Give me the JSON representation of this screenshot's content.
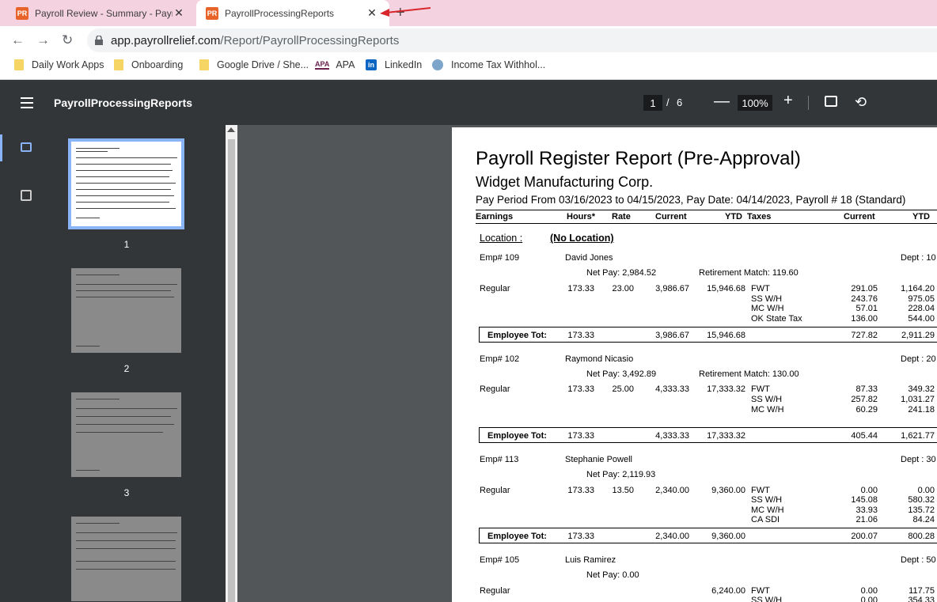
{
  "tabs": [
    {
      "favicon": "PR",
      "title": "Payroll Review - Summary - Payroll Relief",
      "close": "✕"
    },
    {
      "favicon": "PR",
      "title": "PayrollProcessingReports",
      "close": "✕"
    }
  ],
  "new_tab": "+",
  "address": {
    "host": "app.payrollrelief.com",
    "path": "/Report/PayrollProcessingReports"
  },
  "bookmarks": [
    {
      "label": "Daily Work Apps",
      "icon": "folder-icon"
    },
    {
      "label": "Onboarding",
      "icon": "folder-icon"
    },
    {
      "label": "Google Drive / She...",
      "icon": "folder-icon"
    },
    {
      "label": "APA",
      "icon": "apa-icon",
      "icon_text": "APA"
    },
    {
      "label": "LinkedIn",
      "icon": "linkedin-icon",
      "icon_text": "in"
    },
    {
      "label": "Income Tax Withhol...",
      "icon": "irs-icon"
    }
  ],
  "viewer": {
    "title": "PayrollProcessingReports",
    "page_current": "1",
    "page_sep": "/",
    "page_total": "6",
    "zoom": "100%",
    "zoom_minus": "—",
    "zoom_plus": "+"
  },
  "thumbnails": [
    {
      "number": "1",
      "selected": true
    },
    {
      "number": "2",
      "selected": false
    },
    {
      "number": "3",
      "selected": false
    }
  ],
  "report": {
    "title": "Payroll Register Report (Pre-Approval)",
    "company": "Widget Manufacturing Corp.",
    "period": "Pay Period From 03/16/2023 to 04/15/2023, Pay Date: 04/14/2023, Payroll # 18 (Standard)",
    "columns": {
      "earnings": "Earnings",
      "hours": "Hours*",
      "rate": "Rate",
      "current": "Current",
      "ytd": "YTD",
      "taxes": "Taxes",
      "tax_current": "Current",
      "tax_ytd": "YTD"
    },
    "location_label": "Location :",
    "location_value": "(No Location)",
    "employees": [
      {
        "emp": "Emp# 109",
        "name": "David Jones",
        "dept": "Dept : 10",
        "net_pay": "Net Pay:  2,984.52",
        "retirement": "Retirement Match:  119.60",
        "earning": "Regular",
        "hours": "173.33",
        "rate": "23.00",
        "current": "3,986.67",
        "ytd": "15,946.68",
        "taxes": [
          {
            "name": "FWT",
            "current": "291.05",
            "ytd": "1,164.20"
          },
          {
            "name": "SS W/H",
            "current": "243.76",
            "ytd": "975.05"
          },
          {
            "name": "MC W/H",
            "current": "57.01",
            "ytd": "228.04"
          },
          {
            "name": "OK State Tax",
            "current": "136.00",
            "ytd": "544.00"
          }
        ],
        "total_label": "Employee Tot:",
        "tot_hours": "173.33",
        "tot_current": "3,986.67",
        "tot_ytd": "15,946.68",
        "tot_tax_current": "727.82",
        "tot_tax_ytd": "2,911.29"
      },
      {
        "emp": "Emp# 102",
        "name": "Raymond Nicasio",
        "dept": "Dept : 20",
        "net_pay": "Net Pay:  3,492.89",
        "retirement": "Retirement Match:  130.00",
        "earning": "Regular",
        "hours": "173.33",
        "rate": "25.00",
        "current": "4,333.33",
        "ytd": "17,333.32",
        "taxes": [
          {
            "name": "FWT",
            "current": "87.33",
            "ytd": "349.32"
          },
          {
            "name": "SS W/H",
            "current": "257.82",
            "ytd": "1,031.27"
          },
          {
            "name": "MC W/H",
            "current": "60.29",
            "ytd": "241.18"
          }
        ],
        "total_label": "Employee Tot:",
        "tot_hours": "173.33",
        "tot_current": "4,333.33",
        "tot_ytd": "17,333.32",
        "tot_tax_current": "405.44",
        "tot_tax_ytd": "1,621.77"
      },
      {
        "emp": "Emp# 113",
        "name": "Stephanie Powell",
        "dept": "Dept : 30",
        "net_pay": "Net Pay:  2,119.93",
        "retirement": "",
        "earning": "Regular",
        "hours": "173.33",
        "rate": "13.50",
        "current": "2,340.00",
        "ytd": "9,360.00",
        "taxes": [
          {
            "name": "FWT",
            "current": "0.00",
            "ytd": "0.00"
          },
          {
            "name": "SS W/H",
            "current": "145.08",
            "ytd": "580.32"
          },
          {
            "name": "MC W/H",
            "current": "33.93",
            "ytd": "135.72"
          },
          {
            "name": "CA SDI",
            "current": "21.06",
            "ytd": "84.24"
          }
        ],
        "total_label": "Employee Tot:",
        "tot_hours": "173.33",
        "tot_current": "2,340.00",
        "tot_ytd": "9,360.00",
        "tot_tax_current": "200.07",
        "tot_tax_ytd": "800.28"
      },
      {
        "emp": "Emp# 105",
        "name": "Luis Ramirez",
        "dept": "Dept : 50",
        "net_pay": "Net Pay:  0.00",
        "retirement": "",
        "earning": "Regular",
        "hours": "",
        "rate": "",
        "current": "",
        "ytd": "6,240.00",
        "taxes": [
          {
            "name": "FWT",
            "current": "0.00",
            "ytd": "117.75"
          },
          {
            "name": "SS W/H",
            "current": "0.00",
            "ytd": "354.33"
          }
        ]
      }
    ]
  },
  "colors": {
    "tab_strip": "#f5d2e0",
    "viewer_bar": "#323639",
    "accent": "#8ab4f8",
    "favicon": "#e8632a",
    "annotation_arrow": "#d9262c"
  }
}
